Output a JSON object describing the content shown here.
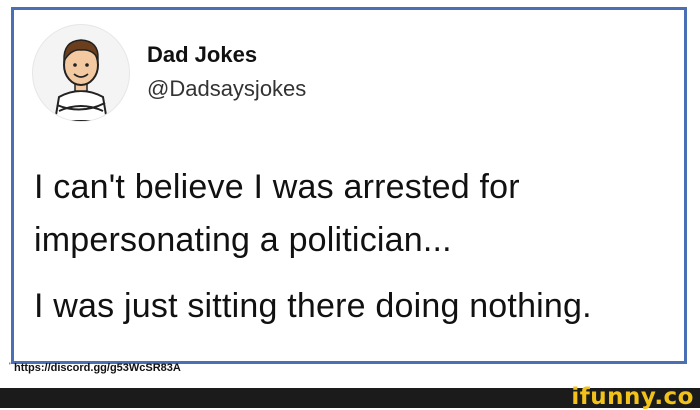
{
  "post": {
    "display_name": "Dad Jokes",
    "handle": "@Dadsaysjokes",
    "avatar_icon": "cartoon-dad-avatar-icon",
    "text_lines": [
      "I can't believe I was arrested for",
      "impersonating a politician...",
      "I was just sitting there doing nothing."
    ]
  },
  "source": {
    "tick": "'",
    "url": "https://discord.gg/g53WcSR83A"
  },
  "footer": {
    "watermark": "ifunny.co"
  },
  "colors": {
    "card_border": "#4a6fb5",
    "footer_bg": "#1b1b1b",
    "watermark": "#f2c21b"
  }
}
